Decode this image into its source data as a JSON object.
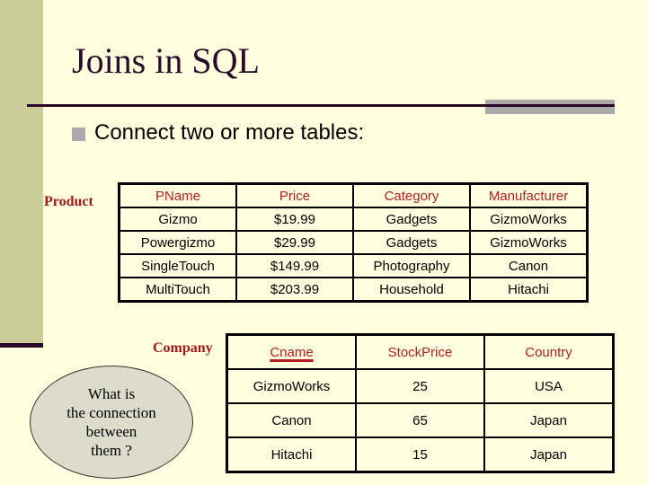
{
  "slide": {
    "title": "Joins in SQL",
    "bullet": "Connect two or more tables:",
    "colors": {
      "background": "#ffffe0",
      "sidebar": "#cccc99",
      "title": "#2a0a28",
      "header_text": "#b02020",
      "ellipse": "#dcdccc"
    }
  },
  "product": {
    "label": "Product",
    "columns": [
      "PName",
      "Price",
      "Category",
      "Manufacturer"
    ],
    "rows": [
      [
        "Gizmo",
        "$19.99",
        "Gadgets",
        "GizmoWorks"
      ],
      [
        "Powergizmo",
        "$29.99",
        "Gadgets",
        "GizmoWorks"
      ],
      [
        "SingleTouch",
        "$149.99",
        "Photography",
        "Canon"
      ],
      [
        "MultiTouch",
        "$203.99",
        "Household",
        "Hitachi"
      ]
    ]
  },
  "company": {
    "label": "Company",
    "columns": [
      "Cname",
      "StockPrice",
      "Country"
    ],
    "key_column": "Cname",
    "rows": [
      [
        "GizmoWorks",
        "25",
        "USA"
      ],
      [
        "Canon",
        "65",
        "Japan"
      ],
      [
        "Hitachi",
        "15",
        "Japan"
      ]
    ]
  },
  "callout": {
    "text": "What is\nthe connection\nbetween\nthem ?"
  }
}
